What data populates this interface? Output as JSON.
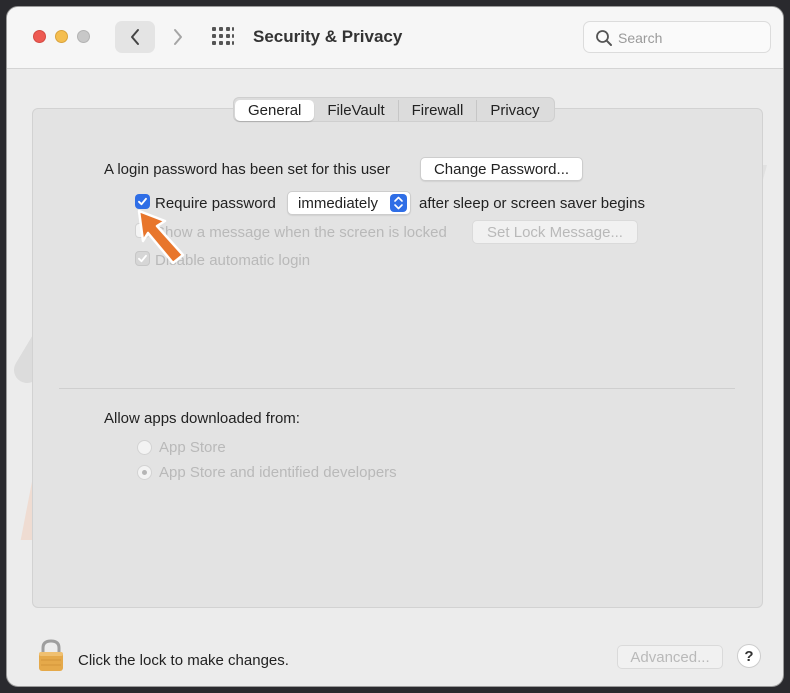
{
  "window": {
    "title": "Security & Privacy"
  },
  "search": {
    "placeholder": "Search"
  },
  "tabs": [
    {
      "label": "General",
      "active": true
    },
    {
      "label": "FileVault",
      "active": false
    },
    {
      "label": "Firewall",
      "active": false
    },
    {
      "label": "Privacy",
      "active": false
    }
  ],
  "general": {
    "login_password_text": "A login password has been set for this user",
    "change_password_label": "Change Password...",
    "require_password_label": "Require password",
    "require_password_checked": true,
    "require_password_delay": "immediately",
    "after_sleep_text": "after sleep or screen saver begins",
    "show_message_label": "Show a message when the screen is locked",
    "show_message_checked": false,
    "set_lock_message_label": "Set Lock Message...",
    "disable_auto_login_label": "Disable automatic login",
    "disable_auto_login_checked": true
  },
  "allow_apps": {
    "heading": "Allow apps downloaded from:",
    "options": [
      {
        "label": "App Store",
        "selected": false
      },
      {
        "label": "App Store and identified developers",
        "selected": true
      }
    ]
  },
  "footer": {
    "lock_text": "Click the lock to make changes.",
    "advanced_label": "Advanced...",
    "help_label": "?"
  },
  "watermark": {
    "text": "risk.com"
  },
  "colors": {
    "accent": "#2f6ee6",
    "annotation_arrow": "#e8762c",
    "close": "#ee5a52",
    "minimize": "#f5be4f"
  }
}
